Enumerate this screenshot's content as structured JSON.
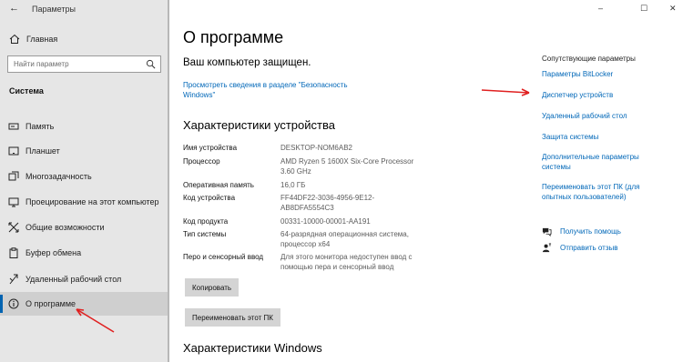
{
  "window": {
    "title": "Параметры",
    "back_icon": "arrow-left-icon",
    "minimize_glyph": "–",
    "maximize_glyph": "☐",
    "close_glyph": "✕"
  },
  "sidebar": {
    "home_label": "Главная",
    "search_placeholder": "Найти параметр",
    "section_label": "Система",
    "items": [
      {
        "label": "Память",
        "icon": "storage-icon"
      },
      {
        "label": "Планшет",
        "icon": "tablet-icon"
      },
      {
        "label": "Многозадачность",
        "icon": "multitasking-icon"
      },
      {
        "label": "Проецирование на этот компьютер",
        "icon": "projecting-icon"
      },
      {
        "label": "Общие возможности",
        "icon": "shared-experiences-icon"
      },
      {
        "label": "Буфер обмена",
        "icon": "clipboard-icon"
      },
      {
        "label": "Удаленный рабочий стол",
        "icon": "remote-desktop-icon"
      },
      {
        "label": "О программе",
        "icon": "info-icon",
        "active": true
      }
    ]
  },
  "main": {
    "title": "О программе",
    "protected_text": "Ваш компьютер защищен.",
    "security_link": "Просмотреть сведения в разделе \"Безопасность Windows\"",
    "device_specs_title": "Характеристики устройства",
    "specs": [
      {
        "key": "Имя устройства",
        "value": "DESKTOP-NOM6AB2"
      },
      {
        "key": "Процессор",
        "value": "AMD Ryzen 5 1600X Six-Core Processor 3.60 GHz"
      },
      {
        "key": "Оперативная память",
        "value": "16,0 ГБ"
      },
      {
        "key": "Код устройства",
        "value": "FF44DF22-3036-4956-9E12-AB8DFA5554C3"
      },
      {
        "key": "Код продукта",
        "value": "00331-10000-00001-AA191"
      },
      {
        "key": "Тип системы",
        "value": "64-разрядная операционная система, процессор x64"
      },
      {
        "key": "Перо и сенсорный ввод",
        "value": "Для этого монитора недоступен ввод с помощью пера и сенсорный ввод"
      }
    ],
    "copy_button": "Копировать",
    "rename_button": "Переименовать этот ПК",
    "windows_specs_title": "Характеристики Windows"
  },
  "related": {
    "heading": "Сопутствующие параметры",
    "links": [
      "Параметры BitLocker",
      "Диспетчер устройств",
      "Удаленный рабочий стол",
      "Защита системы",
      "Дополнительные параметры системы",
      "Переименовать этот ПК (для опытных пользователей)"
    ],
    "help": [
      {
        "label": "Получить помощь",
        "icon": "help-chat-icon"
      },
      {
        "label": "Отправить отзыв",
        "icon": "feedback-icon"
      }
    ]
  },
  "colors": {
    "accent": "#0063b1",
    "link": "#0067b8",
    "sidebar_bg": "#e6e6e6",
    "annotation_arrow": "#e02020"
  }
}
